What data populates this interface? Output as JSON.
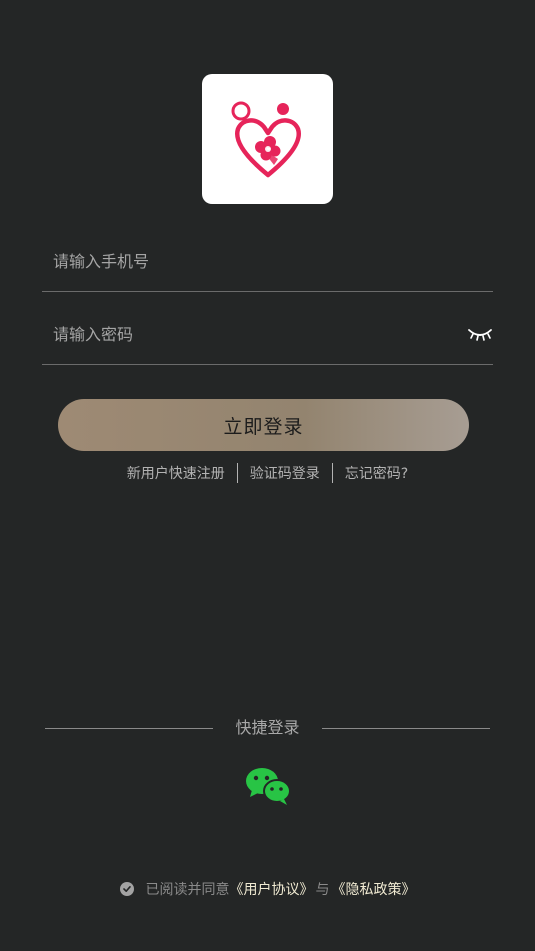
{
  "colors": {
    "background": "#242626",
    "button_gradient_start": "#9e8a74",
    "button_gradient_end": "#a79d93",
    "wechat_green": "#28c445",
    "logo_pink": "#e6245a",
    "policy_link": "#f0ead2"
  },
  "logo": {
    "icon": "heart-family-logo-icon"
  },
  "phone": {
    "placeholder": "请输入手机号",
    "value": ""
  },
  "password": {
    "placeholder": "请输入密码",
    "value": "",
    "toggle_icon": "eye-closed-icon"
  },
  "login_button": {
    "label": "立即登录"
  },
  "links": {
    "register": "新用户快速注册",
    "code_login": "验证码登录",
    "forgot": "忘记密码?"
  },
  "quick_login": {
    "title": "快捷登录",
    "wechat_icon": "wechat-icon"
  },
  "agreement": {
    "check_icon": "check-circle-icon",
    "prefix": "已阅读并同意",
    "user_agreement": "《用户协议》",
    "conjunction": "与",
    "privacy_policy": "《隐私政策》"
  }
}
